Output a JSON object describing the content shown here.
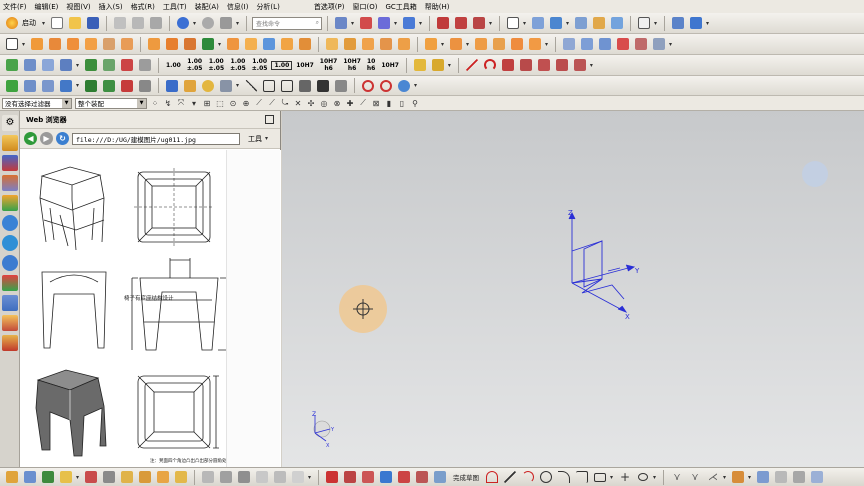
{
  "menu": {
    "items": [
      "文件(F)",
      "编辑(E)",
      "视图(V)",
      "插入(S)",
      "格式(R)",
      "工具(T)",
      "装配(A)",
      "信息(I)",
      "分析(L)",
      "首选项(P)",
      "窗口(O)",
      "GC工具箱",
      "帮助(H)"
    ]
  },
  "toolbar1": {
    "start_label": "启动",
    "search_placeholder": "查找命令"
  },
  "toolbar3": {
    "tolerances": [
      "1.00",
      "1.00\n±.05",
      "1.00\n±.05",
      "1.00\n±.05",
      "1.00\n±.05",
      "1.00",
      "10H7",
      "10H7\nh6",
      "10H7\nh6",
      "10\nh6",
      "10H7"
    ]
  },
  "selection_bar": {
    "filter_value": "没有选择过滤器",
    "scope_value": "整个装配"
  },
  "web_browser": {
    "title": "Web 浏览器",
    "address": "file:///D:/UG/建模图片/ug011.jpg",
    "tools_label": "工具",
    "annotation_text": "椅子有底座结构设计",
    "caption_text": "注：凳面四个角边凸出凸出部分圆角处理"
  },
  "viewport": {
    "axis_labels": {
      "x": "X",
      "y": "Y",
      "z": "Z"
    },
    "triad_labels": {
      "x": "X",
      "y": "Y",
      "z": "Z"
    }
  },
  "bottom_bar": {
    "sketch_label": "完成草图"
  },
  "colors": {
    "viewport_top": "#c7c9cb",
    "viewport_bottom": "#e4e5e6",
    "csys_blue": "#2a2fd6",
    "cursor_halo": "#f0c890"
  }
}
